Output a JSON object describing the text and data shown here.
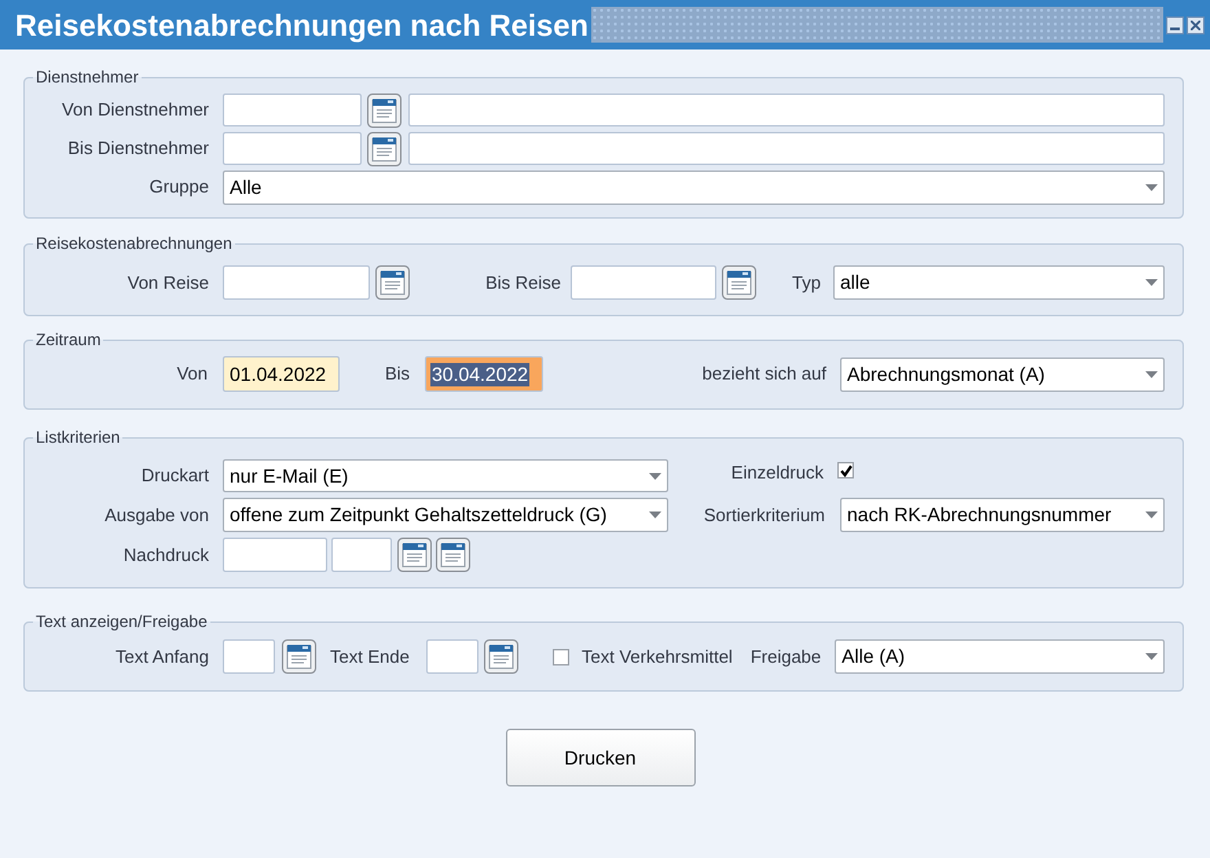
{
  "window": {
    "title": "Reisekostenabrechnungen nach Reisen"
  },
  "dienstnehmer": {
    "legend": "Dienstnehmer",
    "von_label": "Von Dienstnehmer",
    "bis_label": "Bis Dienstnehmer",
    "gruppe_label": "Gruppe",
    "gruppe": "Alle"
  },
  "reisekosten": {
    "legend": "Reisekostenabrechnungen",
    "von_label": "Von Reise",
    "bis_label": "Bis Reise",
    "typ_label": "Typ",
    "typ": "alle"
  },
  "zeitraum": {
    "legend": "Zeitraum",
    "von_label": "Von",
    "von": "01.04.2022",
    "von_focused": false,
    "bis_label": "Bis",
    "bis": "30.04.2022",
    "bis_focused": true,
    "bezug_label": "bezieht sich auf",
    "bezug": "Abrechnungsmonat (A)"
  },
  "listkriterien": {
    "legend": "Listkriterien",
    "druckart_label": "Druckart",
    "druckart": "nur E-Mail (E)",
    "einzeldruck_label": "Einzeldruck",
    "einzeldruck_checked": true,
    "ausgabe_label": "Ausgabe von",
    "ausgabe": "offene zum Zeitpunkt Gehaltszetteldruck (G)",
    "sortier_label": "Sortierkriterium",
    "sortier": "nach RK-Abrechnungsnummer",
    "nachdruck_label": "Nachdruck"
  },
  "text": {
    "legend": "Text anzeigen/Freigabe",
    "anfang_label": "Text Anfang",
    "ende_label": "Text Ende",
    "verkehrsmittel_label": "Text Verkehrsmittel",
    "verkehrsmittel_checked": false,
    "freigabe_label": "Freigabe",
    "freigabe": "Alle (A)"
  },
  "print_button": "Drucken"
}
